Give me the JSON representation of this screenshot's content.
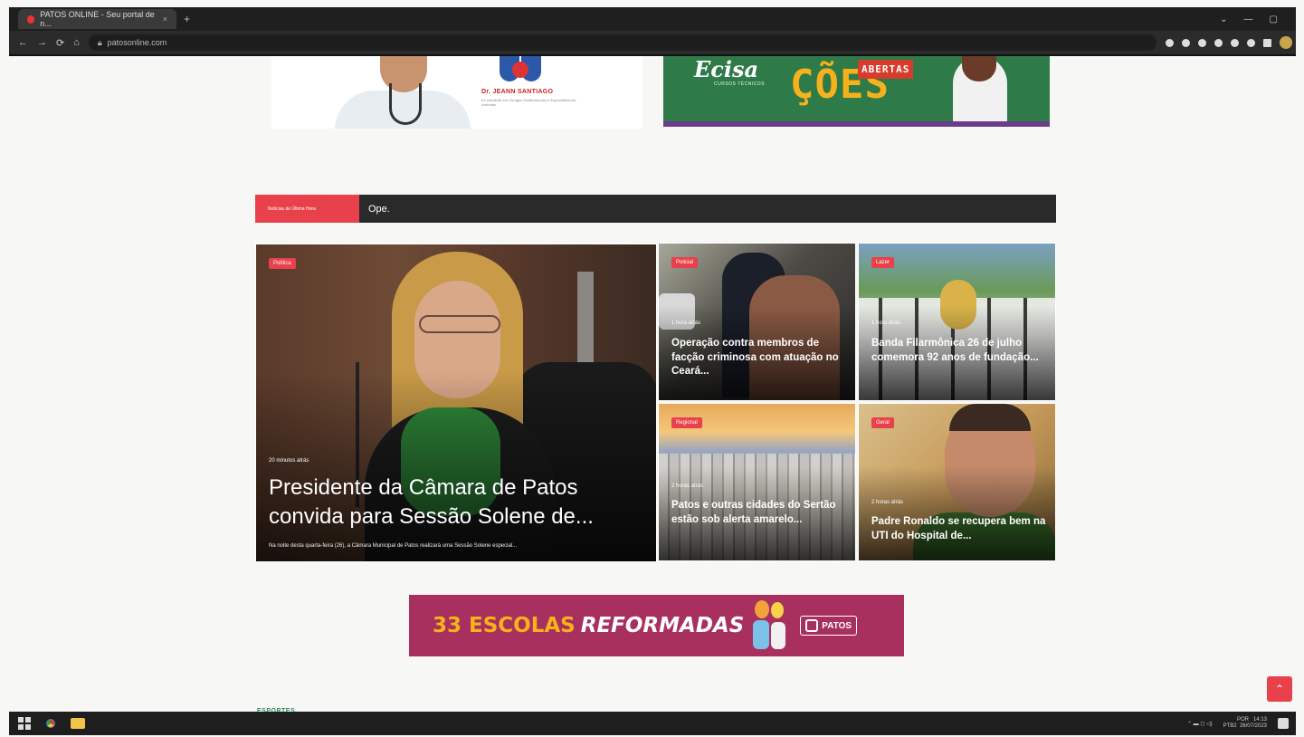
{
  "browser": {
    "tab_title": "PATOS ONLINE - Seu portal de n...",
    "tab_close": "×",
    "new_tab": "+",
    "url": "patosonline.com",
    "nav": [
      "←",
      "→",
      "⟳",
      "⌂"
    ]
  },
  "banners": {
    "doctor_name": "Dr. JEANN SANTIAGO",
    "doctor_sub": "Ex-residente em Cirurgia Cardiovascular e Especialista em Arritmias",
    "ecisa_logo": "Ecisa",
    "ecisa_sub": "CURSOS TÉCNICOS",
    "ecisa_headline": "ÇÕES",
    "ecisa_tag": "ABERTAS"
  },
  "ticker": {
    "label": "Notícias de Última Hora",
    "text": "Ope."
  },
  "news": [
    {
      "category": "Política",
      "time": "20 minutos atrás",
      "title": "Presidente da Câmara de Patos convida para Sessão Solene de...",
      "description": "Na noite desta quarta-feira (26), a Câmara Municipal de Patos realizará uma Sessão Solene especial..."
    },
    {
      "category": "Policial",
      "time": "1 hora atrás",
      "title": "Operação contra membros de facção criminosa com atuação no Ceará..."
    },
    {
      "category": "Lazer",
      "time": "1 hora atrás",
      "title": "Banda Filarmônica 26 de julho comemora 92 anos de fundação..."
    },
    {
      "category": "Regional",
      "time": "2 horas atrás",
      "title": "Patos e outras cidades do Sertão estão sob alerta amarelo..."
    },
    {
      "category": "Geral",
      "time": "2 horas atrás",
      "title": "Padre Ronaldo se recupera bem na UTI do Hospital de..."
    }
  ],
  "ad": {
    "number": "33 ESCOLAS",
    "word": "REFORMADAS",
    "logo": "PATOS"
  },
  "section_next": "ESPORTES",
  "scroll_top": "⌃",
  "taskbar": {
    "lang": "POR",
    "time": "14:13",
    "layout": "PTB2",
    "date": "26/07/2023"
  },
  "colors": {
    "accent_red": "#e8414b",
    "ticker_bg": "#2a2a2a",
    "ad_bg": "#a8305f"
  }
}
